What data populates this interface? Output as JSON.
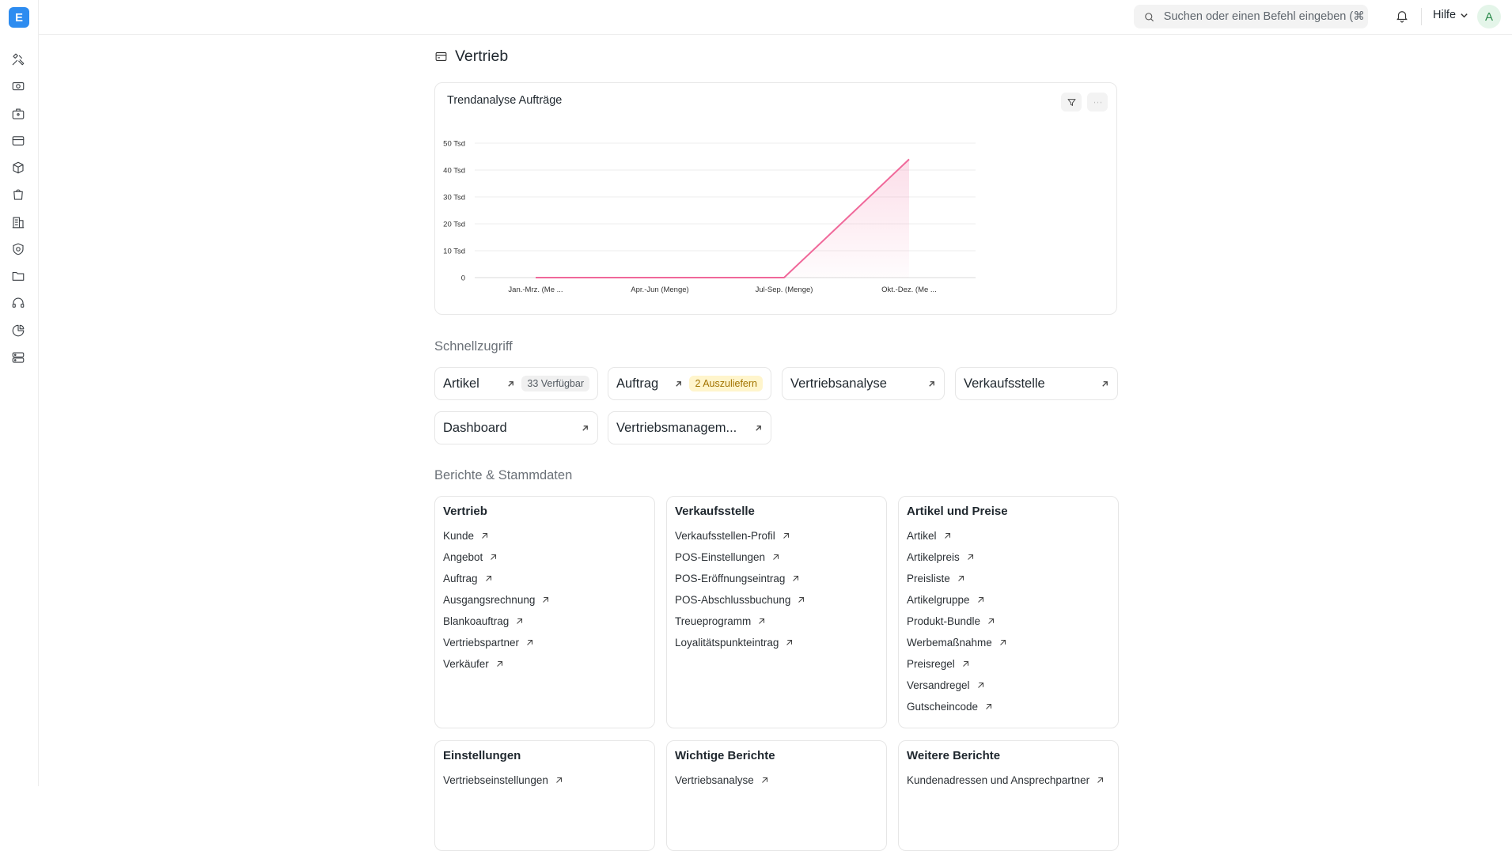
{
  "app": {
    "logo_letter": "E"
  },
  "sidebar": {
    "icons": [
      "tools-icon",
      "money-icon",
      "briefcase-icon",
      "credit-card-icon",
      "package-icon",
      "shopping-bag-icon",
      "building-icon",
      "shield-icon",
      "folder-icon",
      "headset-icon",
      "pie-chart-icon",
      "server-icon"
    ]
  },
  "topbar": {
    "search_placeholder": "Suchen oder einen Befehl eingeben (⌘",
    "help_label": "Hilfe",
    "avatar_initial": "A"
  },
  "page": {
    "title": "Vertrieb"
  },
  "chart": {
    "title": "Trendanalyse Aufträge",
    "filter_icon": "filter-icon",
    "more_icon": "more-icon"
  },
  "chart_data": {
    "type": "line",
    "title": "Trendanalyse Aufträge",
    "categories": [
      "Jan.-Mrz. (Me ...",
      "Apr.-Jun (Menge)",
      "Jul-Sep. (Menge)",
      "Okt.-Dez. (Me ..."
    ],
    "series": [
      {
        "values": [
          0,
          0,
          0,
          44000
        ]
      }
    ],
    "y_ticks": [
      "0",
      "10 Tsd",
      "20 Tsd",
      "30 Tsd",
      "40 Tsd",
      "50 Tsd"
    ],
    "ylim": [
      0,
      50000
    ],
    "line_color": "#f0689a",
    "grid": true
  },
  "quick_access": {
    "heading": "Schnellzugriff",
    "items": [
      {
        "label": "Artikel",
        "badge": "33 Verfügbar",
        "badge_style": "grey"
      },
      {
        "label": "Auftrag",
        "badge": "2 Auszuliefern",
        "badge_style": "yellow"
      },
      {
        "label": "Vertriebsanalyse",
        "badge": ""
      },
      {
        "label": "Verkaufsstelle",
        "badge": ""
      },
      {
        "label": "Dashboard",
        "badge": ""
      },
      {
        "label": "Vertriebsmanagem...",
        "badge": ""
      }
    ]
  },
  "reports": {
    "heading": "Berichte & Stammdaten",
    "cards": [
      {
        "title": "Vertrieb",
        "links": [
          "Kunde",
          "Angebot",
          "Auftrag",
          "Ausgangsrechnung",
          "Blankoauftrag",
          "Vertriebspartner",
          "Verkäufer"
        ]
      },
      {
        "title": "Verkaufsstelle",
        "links": [
          "Verkaufsstellen-Profil",
          "POS-Einstellungen",
          "POS-Eröffnungseintrag",
          "POS-Abschlussbuchung",
          "Treueprogramm",
          "Loyalitätspunkteintrag"
        ]
      },
      {
        "title": "Artikel und Preise",
        "links": [
          "Artikel",
          "Artikelpreis",
          "Preisliste",
          "Artikelgruppe",
          "Produkt-Bundle",
          "Werbemaßnahme",
          "Preisregel",
          "Versandregel",
          "Gutscheincode"
        ]
      },
      {
        "title": "Einstellungen",
        "links": [
          "Vertriebseinstellungen"
        ]
      },
      {
        "title": "Wichtige Berichte",
        "links": [
          "Vertriebsanalyse"
        ]
      },
      {
        "title": "Weitere Berichte",
        "links": [
          "Kundenadressen und Ansprechpartner"
        ]
      }
    ]
  }
}
